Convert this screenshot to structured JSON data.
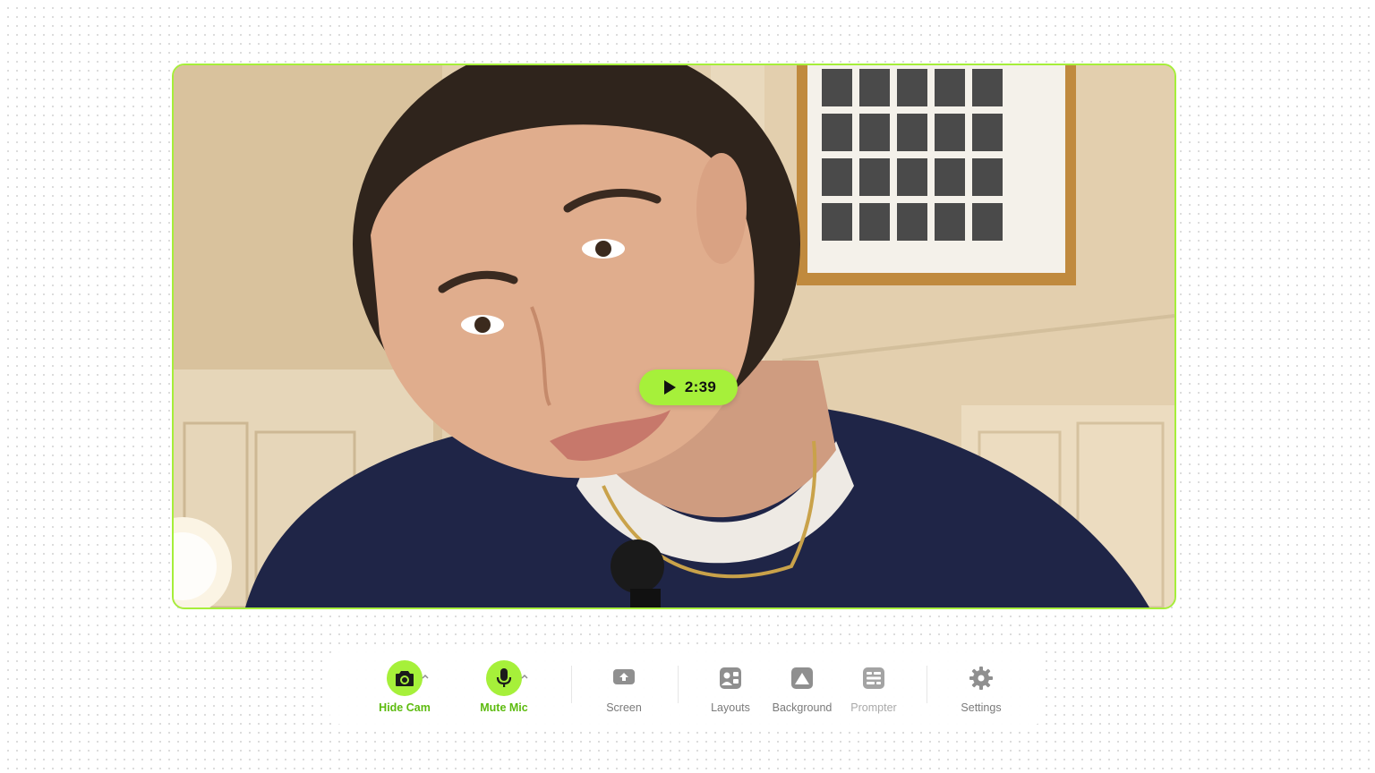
{
  "video": {
    "duration": "2:39",
    "accent_color": "#a6f03a"
  },
  "toolbar": {
    "hide_cam": {
      "label": "Hide Cam",
      "icon": "camera-icon",
      "state": "on"
    },
    "mute_mic": {
      "label": "Mute Mic",
      "icon": "microphone-icon",
      "state": "on"
    },
    "screen": {
      "label": "Screen",
      "icon": "screen-share-icon"
    },
    "layouts": {
      "label": "Layouts",
      "icon": "layouts-icon"
    },
    "background": {
      "label": "Background",
      "icon": "background-image-icon"
    },
    "prompter": {
      "label": "Prompter",
      "icon": "prompter-icon",
      "state": "disabled"
    },
    "settings": {
      "label": "Settings",
      "icon": "gear-icon"
    }
  },
  "colors": {
    "accent_green": "#a6f03a",
    "active_label": "#5dbb0f",
    "icon_grey": "#8f8f8f"
  }
}
